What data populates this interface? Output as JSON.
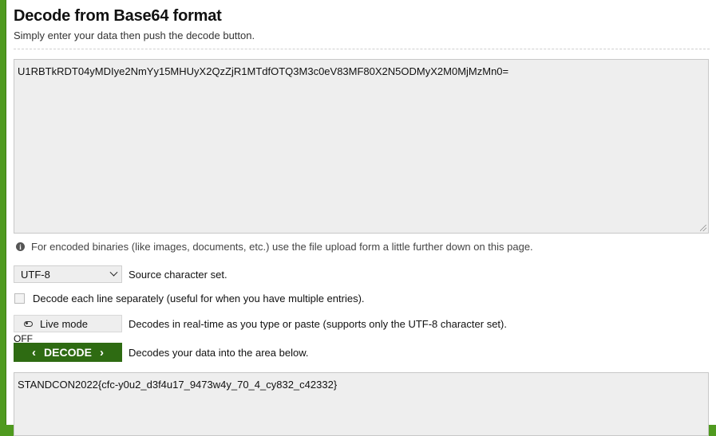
{
  "header": {
    "title": "Decode from Base64 format",
    "subtitle": "Simply enter your data then push the decode button."
  },
  "input": {
    "value": "U1RBTkRDT04yMDIye2NmYy15MHUyX2QzZjR1MTdfOTQ3M3c0eV83MF80X2N5ODMyX2M0MjMzMn0="
  },
  "info": {
    "icon": "info-icon",
    "text": "For encoded binaries (like images, documents, etc.) use the file upload form a little further down on this page."
  },
  "charset": {
    "selected": "UTF-8",
    "label": "Source character set."
  },
  "each_line": {
    "label": "Decode each line separately (useful for when you have multiple entries)."
  },
  "live_mode": {
    "button_label": "Live mode",
    "state": "OFF",
    "description": "Decodes in real-time as you type or paste (supports only the UTF-8 character set)."
  },
  "decode": {
    "button_label": "DECODE",
    "description": "Decodes your data into the area below.",
    "color": "#2e6b12"
  },
  "output": {
    "value": "STANDCON2022{cfc-y0u2_d3f4u17_9473w4y_70_4_cy832_c42332}"
  },
  "colors": {
    "page_background": "#4f9a1f",
    "field_background": "#eeeeee"
  }
}
